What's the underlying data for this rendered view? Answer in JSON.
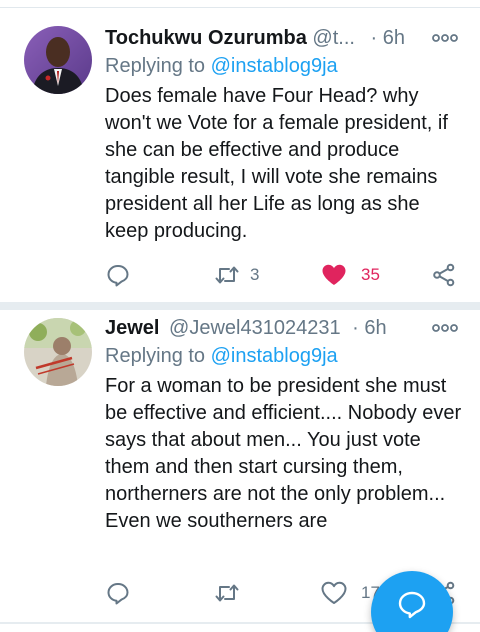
{
  "tweets": [
    {
      "name": "Tochukwu Ozurumba",
      "handle": "@t...",
      "dot": "·",
      "time": "6h",
      "reply_prefix": "Replying to ",
      "reply_mention": "@instablog9ja",
      "text": "Does female have Four Head?  why won't we Vote for a female president, if she can be effective and produce tangible result, I will vote she remains president all her Life as long as she keep producing.",
      "retweets": "3",
      "likes": "35",
      "liked": true
    },
    {
      "name": "Jewel",
      "handle": "@Jewel431024231",
      "dot": "·",
      "time": "6h",
      "reply_prefix": "Replying to ",
      "reply_mention": "@instablog9ja",
      "text": "For a woman to be president she must be effective and efficient.... Nobody ever says that about men... You just vote them and then start cursing them, northerners are not the only problem... Even we southerners are",
      "retweets": "",
      "likes": "17",
      "liked": false
    }
  ],
  "icons": {
    "reply": "reply-icon",
    "retweet": "retweet-icon",
    "like": "heart-icon",
    "share": "share-icon",
    "more": "more-options-icon",
    "compose": "compose-reply-icon"
  },
  "colors": {
    "brand": "#1da1f2",
    "liked": "#e0245e",
    "muted": "#657786",
    "divider": "#e6ecf0"
  }
}
